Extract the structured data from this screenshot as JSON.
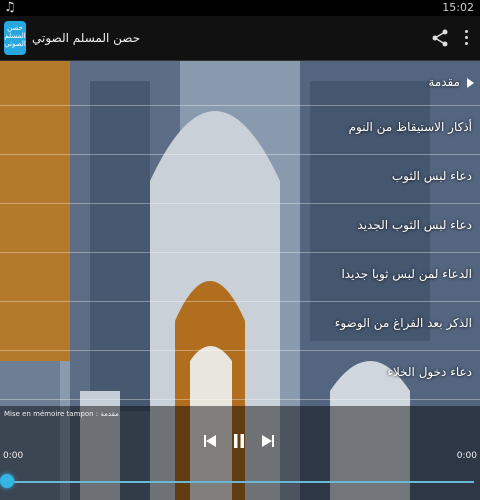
{
  "status_bar": {
    "time": "15:02",
    "notification_icon": "music-note-icon"
  },
  "action_bar": {
    "app_icon_text": "حصن المسلم الصوتي",
    "title": "حصن المسلم الصوتي",
    "share_icon": "share-icon",
    "overflow_icon": "overflow-menu-icon"
  },
  "section_header": "مقدمة",
  "items": [
    {
      "label": "أذكار الاستيقاظ من النوم"
    },
    {
      "label": "دعاء لبس الثوب"
    },
    {
      "label": "دعاء لبس الثوب الجديد"
    },
    {
      "label": "الدعاء لمن لبس ثوبا جديدا"
    },
    {
      "label": "الذكر بعد الفراغ من الوضوء"
    },
    {
      "label": "دعاء دخول الخلاء"
    }
  ],
  "player": {
    "now_playing": "Mise en mémoire tampon : مقدمة",
    "elapsed": "0:00",
    "duration": "0:00",
    "progress": 0
  },
  "colors": {
    "accent": "#33b5e5",
    "action_bar": "#111111"
  }
}
